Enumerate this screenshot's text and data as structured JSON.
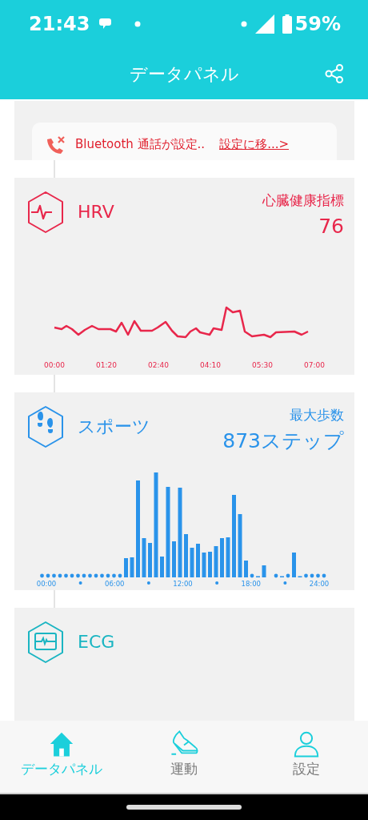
{
  "status_bar": {
    "time": "21:43",
    "battery": "59%"
  },
  "header": {
    "title": "データパネル"
  },
  "notice": {
    "message": "Bluetooth 通話が設定..",
    "action": "設定に移...>"
  },
  "cards": [
    {
      "kind": "hrv",
      "title": "HRV",
      "metric_label": "心臓健康指標",
      "metric_value": "76",
      "color": "#e8274b",
      "x_labels": [
        "00:00",
        "01:20",
        "02:40",
        "04:10",
        "05:30",
        "07:00"
      ]
    },
    {
      "kind": "steps",
      "title": "スポーツ",
      "metric_label": "最大歩数",
      "metric_value": "873ステップ",
      "color": "#2a93ea",
      "x_labels": [
        "00:00",
        "06:00",
        "12:00",
        "18:00",
        "24:00"
      ]
    },
    {
      "kind": "ecg",
      "title": "ECG",
      "color": "#1ab5c2"
    }
  ],
  "tabs": [
    {
      "kind": "home",
      "label": "データパネル",
      "selected": true
    },
    {
      "kind": "sport",
      "label": "運動",
      "selected": false
    },
    {
      "kind": "person",
      "label": "設定",
      "selected": false
    }
  ]
}
